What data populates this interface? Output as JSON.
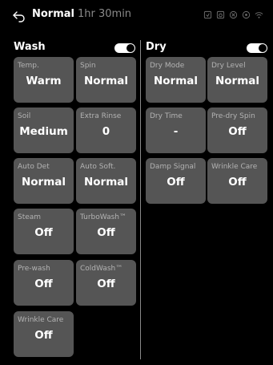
{
  "header": {
    "mode": "Normal",
    "time": "1hr 30min",
    "status_icons": [
      "remote-start-icon",
      "child-lock-icon",
      "favorite-icon",
      "smart-diagnosis-icon",
      "wifi-icon"
    ]
  },
  "wash": {
    "label": "Wash",
    "toggle_on": true,
    "tiles": [
      {
        "label": "Temp.",
        "value": "Warm"
      },
      {
        "label": "Spin",
        "value": "Normal"
      },
      {
        "label": "Soil",
        "value": "Medium"
      },
      {
        "label": "Extra Rinse",
        "value": "0"
      },
      {
        "label": "Auto Det",
        "value": "Normal"
      },
      {
        "label": "Auto Soft.",
        "value": "Normal"
      },
      {
        "label": "Steam",
        "value": "Off"
      },
      {
        "label": "TurboWash™",
        "value": "Off"
      },
      {
        "label": "Pre-wash",
        "value": "Off"
      },
      {
        "label": "ColdWash™",
        "value": "Off"
      },
      {
        "label": "Wrinkle Care",
        "value": "Off"
      }
    ]
  },
  "dry": {
    "label": "Dry",
    "toggle_on": true,
    "tiles": [
      {
        "label": "Dry Mode",
        "value": "Normal"
      },
      {
        "label": "Dry Level",
        "value": "Normal"
      },
      {
        "label": "Dry Time",
        "value": "-"
      },
      {
        "label": "Pre-dry Spin",
        "value": "Off"
      },
      {
        "label": "Damp Signal",
        "value": "Off"
      },
      {
        "label": "Wrinkle Care",
        "value": "Off"
      }
    ]
  },
  "colors": {
    "background": "#000000",
    "tile": "#555555",
    "tile_label": "#b3b3b3",
    "muted_text": "#8a8a8a"
  }
}
